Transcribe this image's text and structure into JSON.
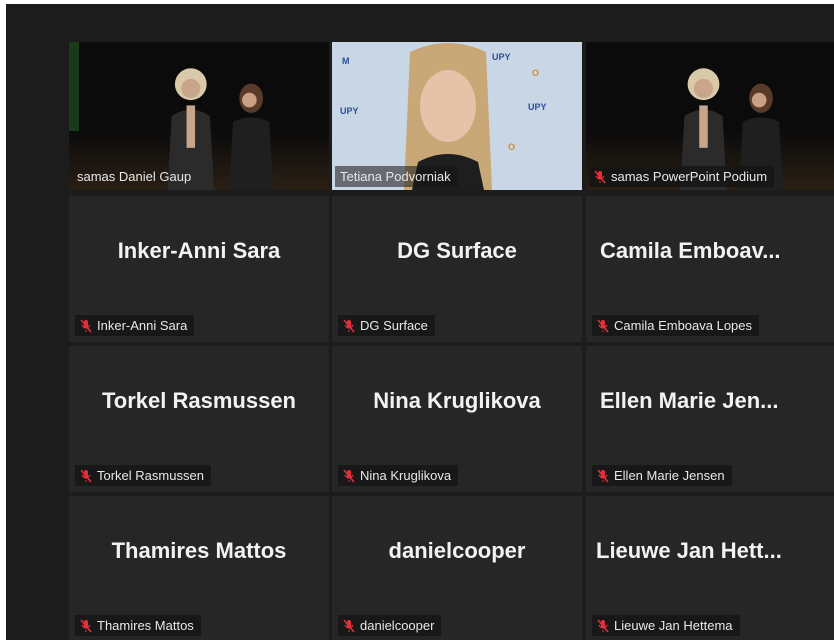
{
  "tiles": [
    {
      "name": "samas Daniel Gaup",
      "muted": false,
      "type": "video-stage",
      "active": true
    },
    {
      "name": "Tetiana Podvorniak",
      "muted": false,
      "type": "video-office",
      "active": false
    },
    {
      "name": "samas PowerPoint Podium",
      "muted": true,
      "type": "video-stage",
      "active": false
    },
    {
      "display": "Inker-Anni Sara",
      "name": "Inker-Anni Sara",
      "muted": true
    },
    {
      "display": "DG Surface",
      "name": "DG Surface",
      "muted": true
    },
    {
      "display": "Camila  Emboav...",
      "name": "Camila Emboava Lopes",
      "muted": true
    },
    {
      "display": "Torkel Rasmussen",
      "name": "Torkel Rasmussen",
      "muted": true
    },
    {
      "display": "Nina Kruglikova",
      "name": "Nina Kruglikova",
      "muted": true
    },
    {
      "display": "Ellen  Marie  Jen...",
      "name": "Ellen Marie Jensen",
      "muted": true
    },
    {
      "display": "Thamires Mattos",
      "name": "Thamires Mattos",
      "muted": true
    },
    {
      "display": "danielcooper",
      "name": "danielcooper",
      "muted": true
    },
    {
      "display": "Lieuwe  Jan  Hett...",
      "name": "Lieuwe Jan Hettema",
      "muted": true
    }
  ],
  "colors": {
    "active_border": "#d8d36a",
    "mute_icon": "#e0303a",
    "tile_bg": "#262626"
  }
}
